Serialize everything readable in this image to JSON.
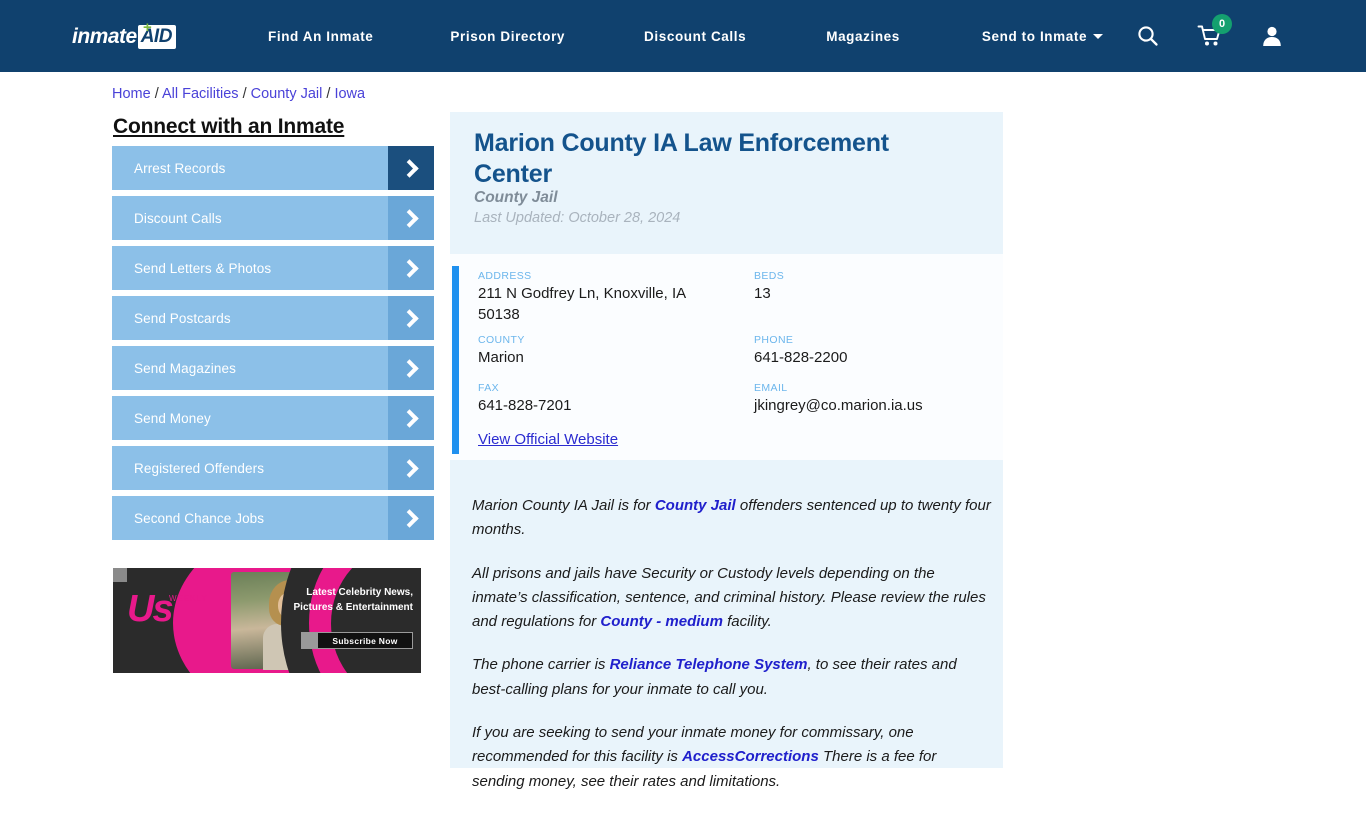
{
  "header": {
    "logo": {
      "word": "inmate",
      "box": "AID",
      "plus": "+"
    },
    "nav": [
      {
        "label": "Find An Inmate"
      },
      {
        "label": "Prison Directory"
      },
      {
        "label": "Discount Calls"
      },
      {
        "label": "Magazines"
      },
      {
        "label": "Send to Inmate",
        "has_caret": true
      }
    ],
    "icons": {
      "search": "search-icon",
      "cart": "cart-icon",
      "cart_badge": "0",
      "account": "user-icon"
    },
    "bg_color": "#10416e",
    "badge_color": "#14a06f"
  },
  "breadcrumb": {
    "items": [
      "Home",
      "All Facilities",
      "County Jail",
      "Iowa"
    ],
    "separator": "/",
    "link_color": "#4a42d8"
  },
  "sidebar": {
    "title": "Connect with an Inmate",
    "items": [
      {
        "label": "Arrest Records",
        "active": true
      },
      {
        "label": "Discount Calls",
        "active": false
      },
      {
        "label": "Send Letters & Photos",
        "active": false
      },
      {
        "label": "Send Postcards",
        "active": false
      },
      {
        "label": "Send Magazines",
        "active": false
      },
      {
        "label": "Send Money",
        "active": false
      },
      {
        "label": "Registered Offenders",
        "active": false
      },
      {
        "label": "Second Chance Jobs",
        "active": false
      }
    ],
    "button_color": "#8cc0e8",
    "arrow_color": "#6aa7d8",
    "arrow_active_color": "#1b4f7e"
  },
  "ad": {
    "brand": "Us",
    "brand_dots": "WEEKLY",
    "headline": "Latest Celebrity News, Pictures & Entertainment",
    "cta": "Subscribe Now",
    "accent_color": "#e8198b"
  },
  "facility": {
    "title": "Marion County IA Law Enforcement Center",
    "subtitle": "County Jail",
    "last_updated": "Last Updated: October 28, 2024",
    "fields": {
      "address_label": "ADDRESS",
      "address_value": "211 N Godfrey Ln, Knoxville, IA 50138",
      "beds_label": "BEDS",
      "beds_value": "13",
      "county_label": "COUNTY",
      "county_value": "Marion",
      "phone_label": "PHONE",
      "phone_value": "641-828-2200",
      "fax_label": "FAX",
      "fax_value": "641-828-7201",
      "email_label": "EMAIL",
      "email_value": "jkingrey@co.marion.ia.us"
    },
    "website_link": "View Official Website",
    "title_color": "#14538c",
    "accent_color": "#1e90ef"
  },
  "body": {
    "p1_a": "Marion County IA Jail is for ",
    "p1_link": "County Jail",
    "p1_b": " offenders sentenced up to twenty four months.",
    "p2_a": "All prisons and jails have Security or Custody levels depending on the inmate’s classification, sentence, and criminal history. Please review the rules and regulations for ",
    "p2_link": "County - medium",
    "p2_b": " facility.",
    "p3_a": "The phone carrier is ",
    "p3_link": "Reliance Telephone System",
    "p3_b": ", to see their rates and best-calling plans for your inmate to call you.",
    "p4_a": "If you are seeking to send your inmate money for commissary, one recommended for this facility is ",
    "p4_link": "AccessCorrections",
    "p4_b": " There is a fee for sending money, see their rates and limitations."
  }
}
